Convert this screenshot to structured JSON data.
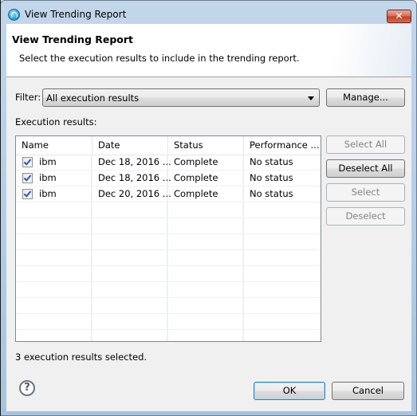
{
  "window": {
    "title": "View Trending Report",
    "app_icon": "eclipse-globe-icon",
    "close_label": "✕"
  },
  "header": {
    "title": "View Trending Report",
    "description": "Select the execution results to include in the trending report."
  },
  "filter": {
    "label": "Filter:",
    "selected": "All execution results",
    "manage_label": "Manage..."
  },
  "results": {
    "label": "Execution results:",
    "columns": [
      "Name",
      "Date",
      "Status",
      "Performance ..."
    ],
    "rows": [
      {
        "checked": true,
        "name": "ibm",
        "date": "Dec 18, 2016 ...",
        "status": "Complete",
        "performance": "No status"
      },
      {
        "checked": true,
        "name": "ibm",
        "date": "Dec 18, 2016 ...",
        "status": "Complete",
        "performance": "No status"
      },
      {
        "checked": true,
        "name": "ibm",
        "date": "Dec 20, 2016 ...",
        "status": "Complete",
        "performance": "No status"
      }
    ]
  },
  "side_buttons": {
    "select_all": "Select All",
    "deselect_all": "Deselect All",
    "select": "Select",
    "deselect": "Deselect"
  },
  "status": "3 execution results selected.",
  "footer": {
    "help_icon": "?",
    "ok_label": "OK",
    "cancel_label": "Cancel"
  }
}
